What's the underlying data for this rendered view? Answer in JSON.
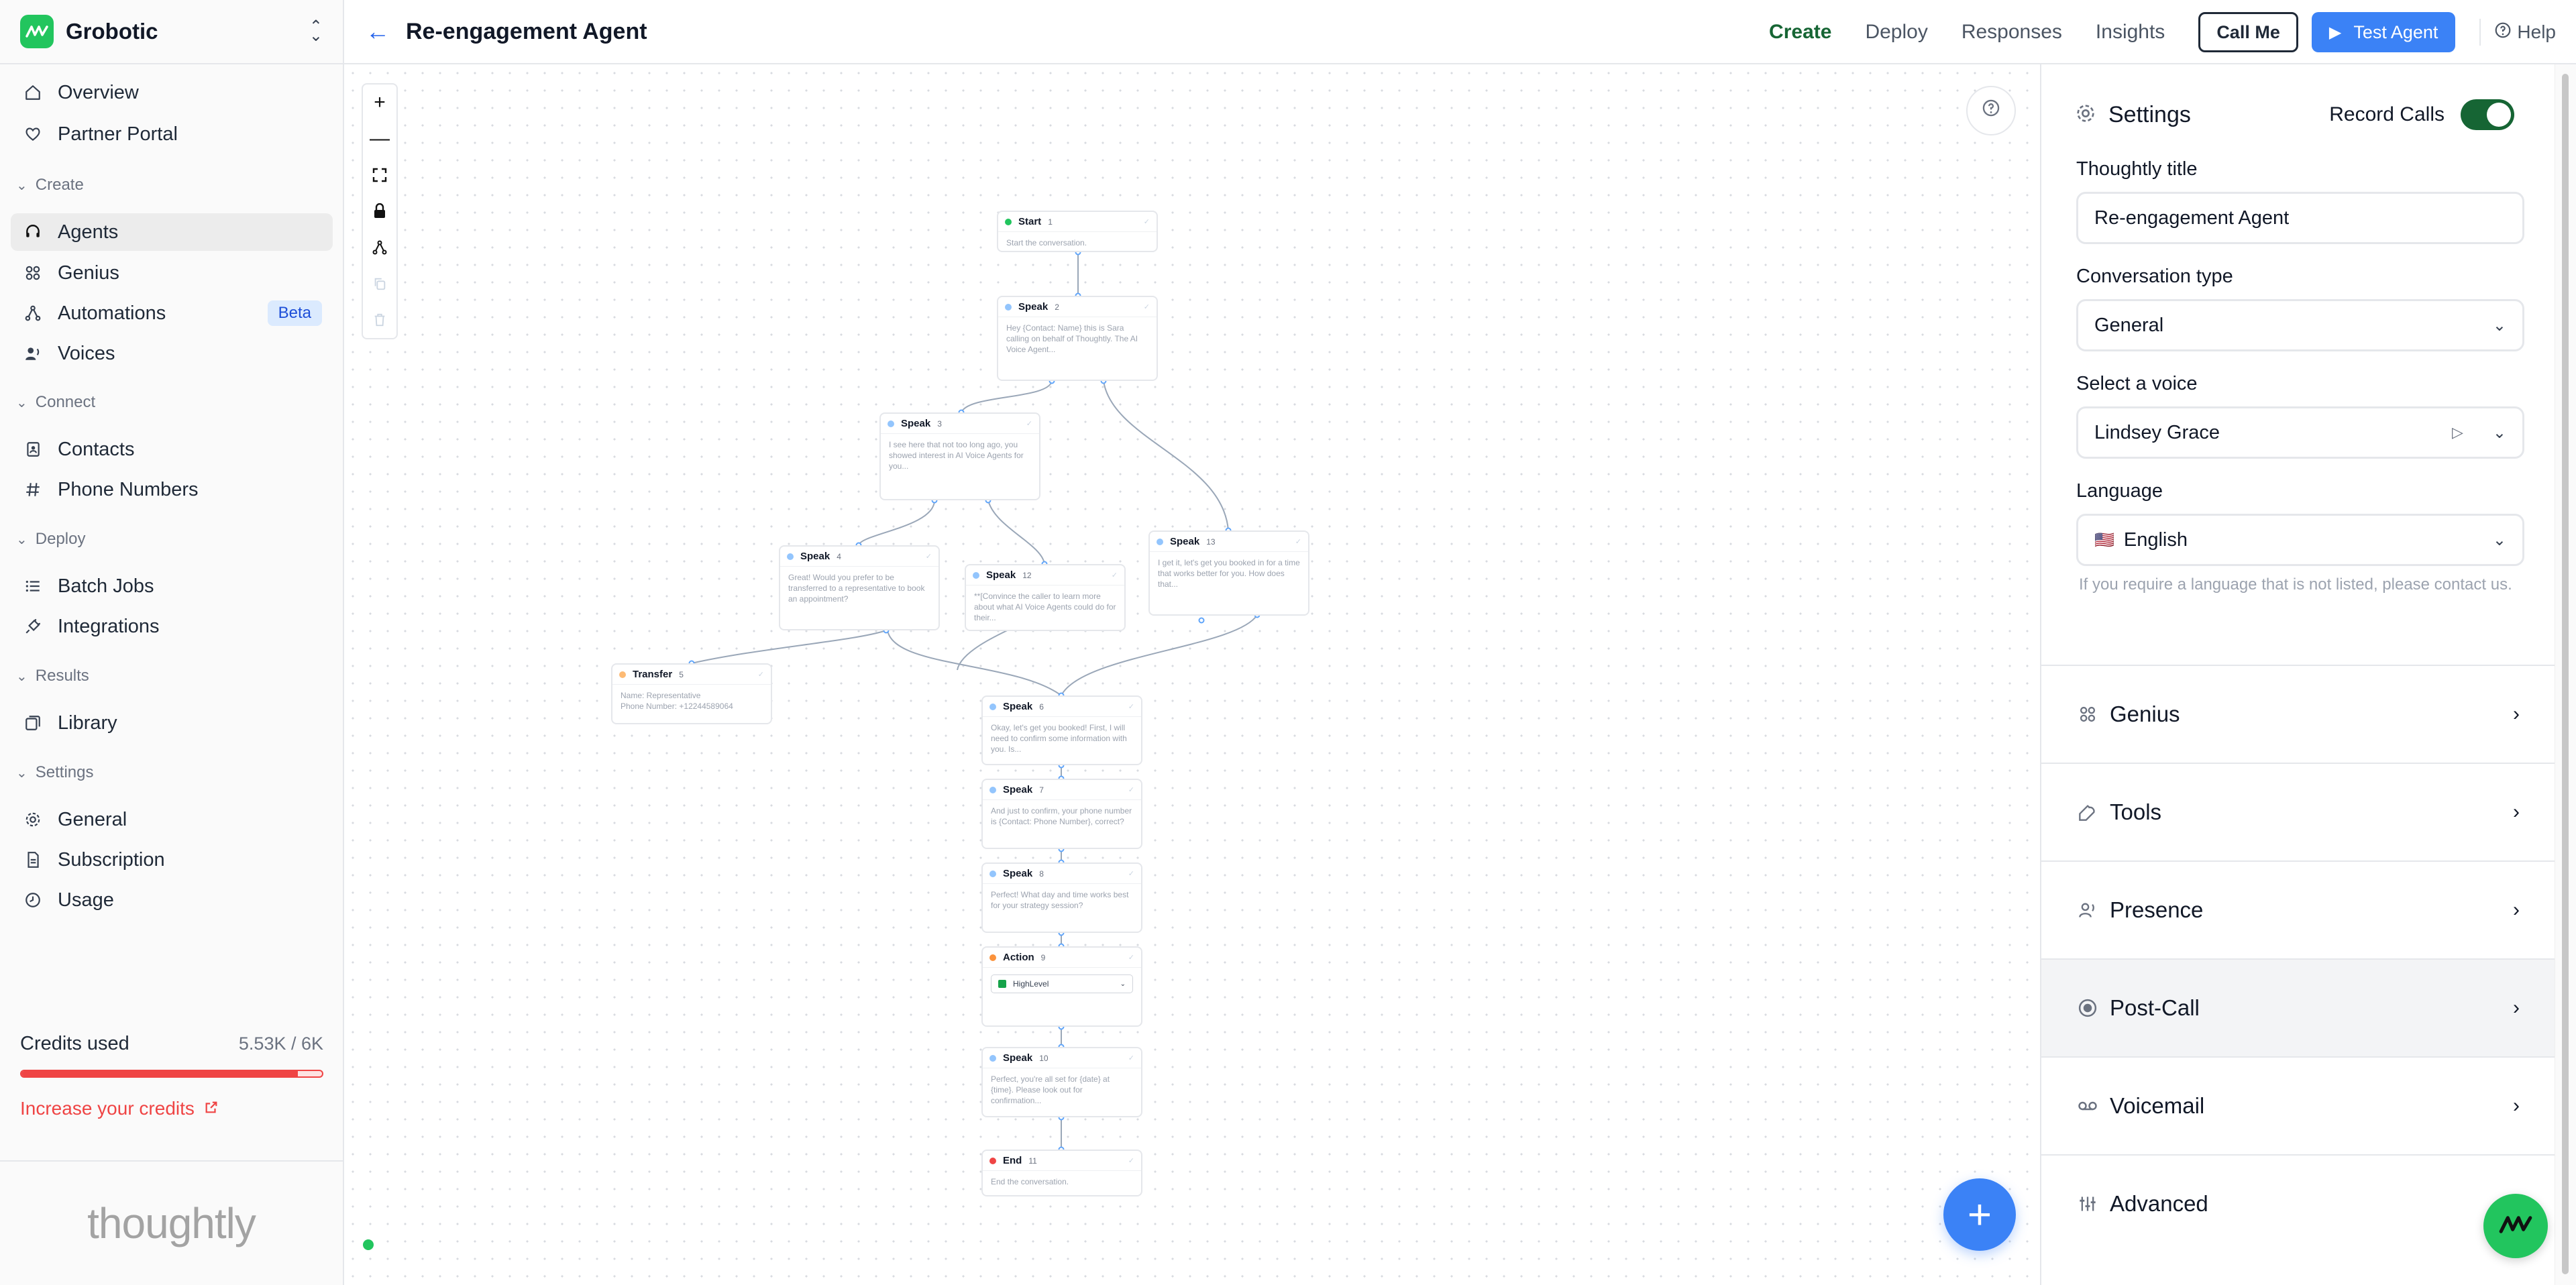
{
  "workspace": {
    "name": "Grobotic"
  },
  "sidebar": {
    "overview": "Overview",
    "partner_portal": "Partner Portal",
    "create_section": "Create",
    "agents": "Agents",
    "genius": "Genius",
    "automations": "Automations",
    "automations_badge": "Beta",
    "voices": "Voices",
    "connect_section": "Connect",
    "contacts": "Contacts",
    "phone_numbers": "Phone Numbers",
    "deploy_section": "Deploy",
    "batch_jobs": "Batch Jobs",
    "integrations": "Integrations",
    "results_section": "Results",
    "library": "Library",
    "settings_section": "Settings",
    "general": "General",
    "subscription": "Subscription",
    "usage": "Usage"
  },
  "credits": {
    "label": "Credits used",
    "value": "5.53K / 6K",
    "used_fraction": 0.92,
    "increase_link": "Increase your credits"
  },
  "brand": {
    "wordmark": "thoughtly"
  },
  "header": {
    "title": "Re-engagement Agent",
    "tabs": {
      "create": "Create",
      "deploy": "Deploy",
      "responses": "Responses",
      "insights": "Insights"
    },
    "call_me": "Call Me",
    "test_agent": "Test Agent",
    "help": "Help"
  },
  "flow": {
    "n_start_title": "Start",
    "n_start_num": "1",
    "n_start_text": "Start the conversation.",
    "n_s2_title": "Speak",
    "n_s2_num": "2",
    "n_s2_text": "Hey {Contact: Name} this is Sara calling on behalf of Thoughtly. The AI Voice Agent...",
    "n_s3_title": "Speak",
    "n_s3_num": "3",
    "n_s3_text": "I see here that not too long ago, you showed interest in AI Voice Agents for you...",
    "n_s4_title": "Speak",
    "n_s4_num": "4",
    "n_s4_text": "Great! Would you prefer to be transferred to a representative to book an appointment?",
    "n_s12_title": "Speak",
    "n_s12_num": "12",
    "n_s12_text": "**[Convince the caller to learn more about what AI Voice Agents could do for their...",
    "n_s13_title": "Speak",
    "n_s13_num": "13",
    "n_s13_text": "I get it, let's get you booked in for a time that works better for you. How does that...",
    "n_t5_title": "Transfer",
    "n_t5_num": "5",
    "n_t5_line1": "Name: Representative",
    "n_t5_line2": "Phone Number: +12244589064",
    "n_s6_title": "Speak",
    "n_s6_num": "6",
    "n_s6_text": "Okay, let's get you booked! First, I will need to confirm some information with you. Is...",
    "n_s7_title": "Speak",
    "n_s7_num": "7",
    "n_s7_text": "And just to confirm, your phone number is {Contact: Phone Number}, correct?",
    "n_s8_title": "Speak",
    "n_s8_num": "8",
    "n_s8_text": "Perfect! What day and time works best for your strategy session?",
    "n_a9_title": "Action",
    "n_a9_num": "9",
    "n_a9_select": "HighLevel",
    "n_s10_title": "Speak",
    "n_s10_num": "10",
    "n_s10_text": "Perfect, you're all set for {date} at {time}. Please look out for confirmation...",
    "n_e11_title": "End",
    "n_e11_num": "11",
    "n_e11_text": "End the conversation."
  },
  "settings": {
    "title": "Settings",
    "record_calls_label": "Record Calls",
    "record_calls_on": true,
    "title_label": "Thoughtly title",
    "title_value": "Re-engagement Agent",
    "conv_type_label": "Conversation type",
    "conv_type_value": "General",
    "voice_label": "Select a voice",
    "voice_value": "Lindsey Grace",
    "language_label": "Language",
    "language_flag": "🇺🇸",
    "language_value": "English",
    "language_note": "If you require a language that is not listed, please contact us."
  },
  "sections": {
    "genius": "Genius",
    "tools": "Tools",
    "presence": "Presence",
    "post_call": "Post-Call",
    "voicemail": "Voicemail",
    "advanced": "Advanced"
  },
  "colors": {
    "accent_green": "#166534",
    "brand_green": "#22c55e",
    "primary_blue": "#3b82f6",
    "danger": "#ef4444"
  }
}
